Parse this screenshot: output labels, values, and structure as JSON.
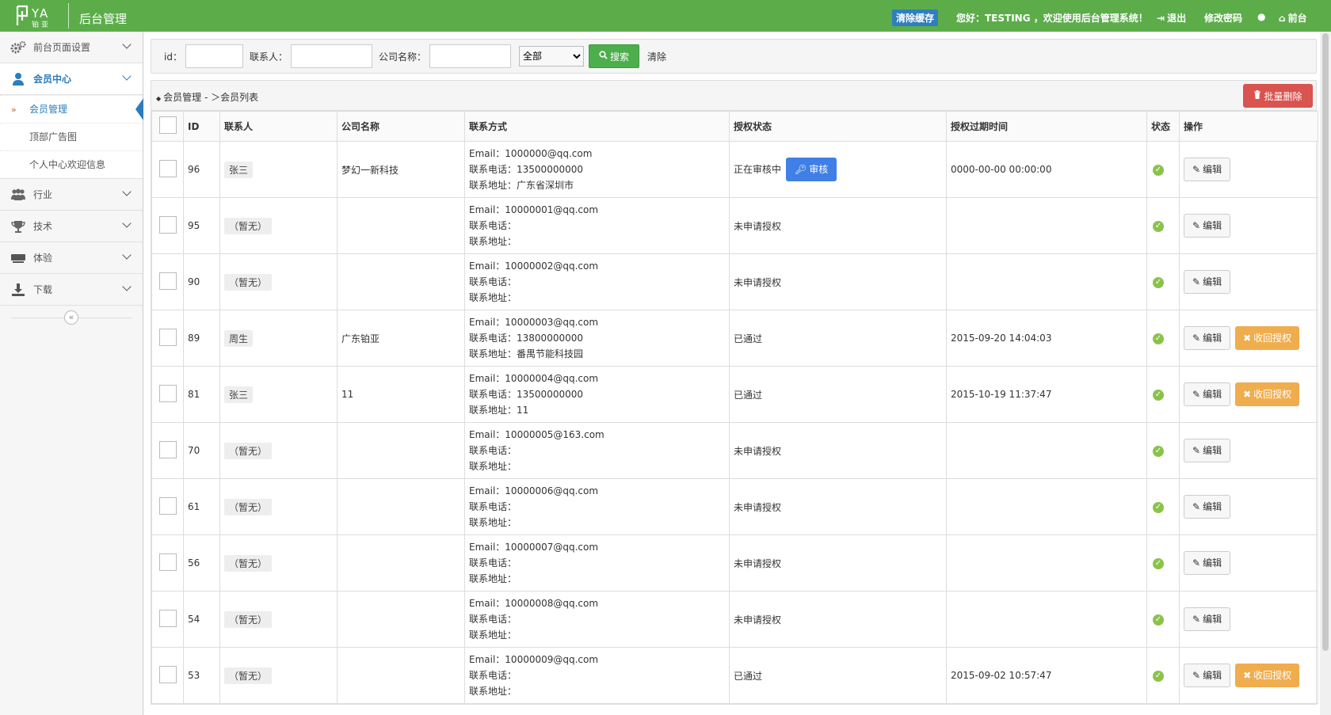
{
  "header": {
    "logo_text": "铂亚",
    "logo_letters": "YA",
    "app_title": "后台管理",
    "clear_cache": "清除缓存",
    "welcome": "您好：TESTING ，欢迎使用后台管理系统！",
    "logout": "退出",
    "change_password": "修改密码",
    "frontend": "前台",
    "accent_color": "#5cad4a"
  },
  "sidebar": {
    "items": [
      {
        "label": "前台页面设置",
        "icon": "gears-icon"
      },
      {
        "label": "会员中心",
        "icon": "user-icon"
      },
      {
        "label": "行业",
        "icon": "users-icon"
      },
      {
        "label": "技术",
        "icon": "trophy-icon"
      },
      {
        "label": "体验",
        "icon": "keyboard-icon"
      },
      {
        "label": "下载",
        "icon": "download-icon"
      }
    ],
    "sub_items": [
      {
        "label": "会员管理"
      },
      {
        "label": "顶部广告图"
      },
      {
        "label": "个人中心欢迎信息"
      }
    ],
    "collapse_glyph": "«"
  },
  "search": {
    "id_label": "id：",
    "contact_label": "联系人：",
    "company_label": "公司名称：",
    "select_value": "全部",
    "search_button": "搜索",
    "clear_button": "清除"
  },
  "list": {
    "breadcrumb": "会员管理 - ＞会员列表",
    "batch_delete": "批量删除",
    "columns": [
      "ID",
      "联系人",
      "公司名称",
      "联系方式",
      "授权状态",
      "授权过期时间",
      "状态",
      "操作"
    ],
    "audit_button": "审核",
    "edit_button": "编辑",
    "revoke_button": "收回授权",
    "email_prefix": "Email：",
    "phone_prefix": "联系电话：",
    "address_prefix": "联系地址：",
    "rows": [
      {
        "id": "96",
        "contact": "张三",
        "company": "梦幻一新科技",
        "email": "1000000@qq.com",
        "phone": "13500000000",
        "address": "广东省深圳市",
        "auth": "正在审核中",
        "expire": "0000-00-00 00:00:00",
        "audit": true,
        "revoke": false
      },
      {
        "id": "95",
        "contact": "（暂无）",
        "company": "",
        "email": "10000001@qq.com",
        "phone": "",
        "address": "",
        "auth": "未申请授权",
        "expire": "",
        "audit": false,
        "revoke": false
      },
      {
        "id": "90",
        "contact": "（暂无）",
        "company": "",
        "email": "10000002@qq.com",
        "phone": "",
        "address": "",
        "auth": "未申请授权",
        "expire": "",
        "audit": false,
        "revoke": false
      },
      {
        "id": "89",
        "contact": "周生",
        "company": "广东铂亚",
        "email": "10000003@qq.com",
        "phone": "13800000000",
        "address": "番禺节能科技园",
        "auth": "已通过",
        "expire": "2015-09-20 14:04:03",
        "audit": false,
        "revoke": true
      },
      {
        "id": "81",
        "contact": "张三",
        "company": "11",
        "email": "10000004@qq.com",
        "phone": "13500000000",
        "address": "11",
        "auth": "已通过",
        "expire": "2015-10-19 11:37:47",
        "audit": false,
        "revoke": true
      },
      {
        "id": "70",
        "contact": "（暂无）",
        "company": "",
        "email": "10000005@163.com",
        "phone": "",
        "address": "",
        "auth": "未申请授权",
        "expire": "",
        "audit": false,
        "revoke": false
      },
      {
        "id": "61",
        "contact": "（暂无）",
        "company": "",
        "email": "10000006@qq.com",
        "phone": "",
        "address": "",
        "auth": "未申请授权",
        "expire": "",
        "audit": false,
        "revoke": false
      },
      {
        "id": "56",
        "contact": "（暂无）",
        "company": "",
        "email": "10000007@qq.com",
        "phone": "",
        "address": "",
        "auth": "未申请授权",
        "expire": "",
        "audit": false,
        "revoke": false
      },
      {
        "id": "54",
        "contact": "（暂无）",
        "company": "",
        "email": "10000008@qq.com",
        "phone": "",
        "address": "",
        "auth": "未申请授权",
        "expire": "",
        "audit": false,
        "revoke": false
      },
      {
        "id": "53",
        "contact": "（暂无）",
        "company": "",
        "email": "10000009@qq.com",
        "phone": "",
        "address": "",
        "auth": "已通过",
        "expire": "2015-09-02 10:57:47",
        "audit": false,
        "revoke": true
      }
    ]
  }
}
